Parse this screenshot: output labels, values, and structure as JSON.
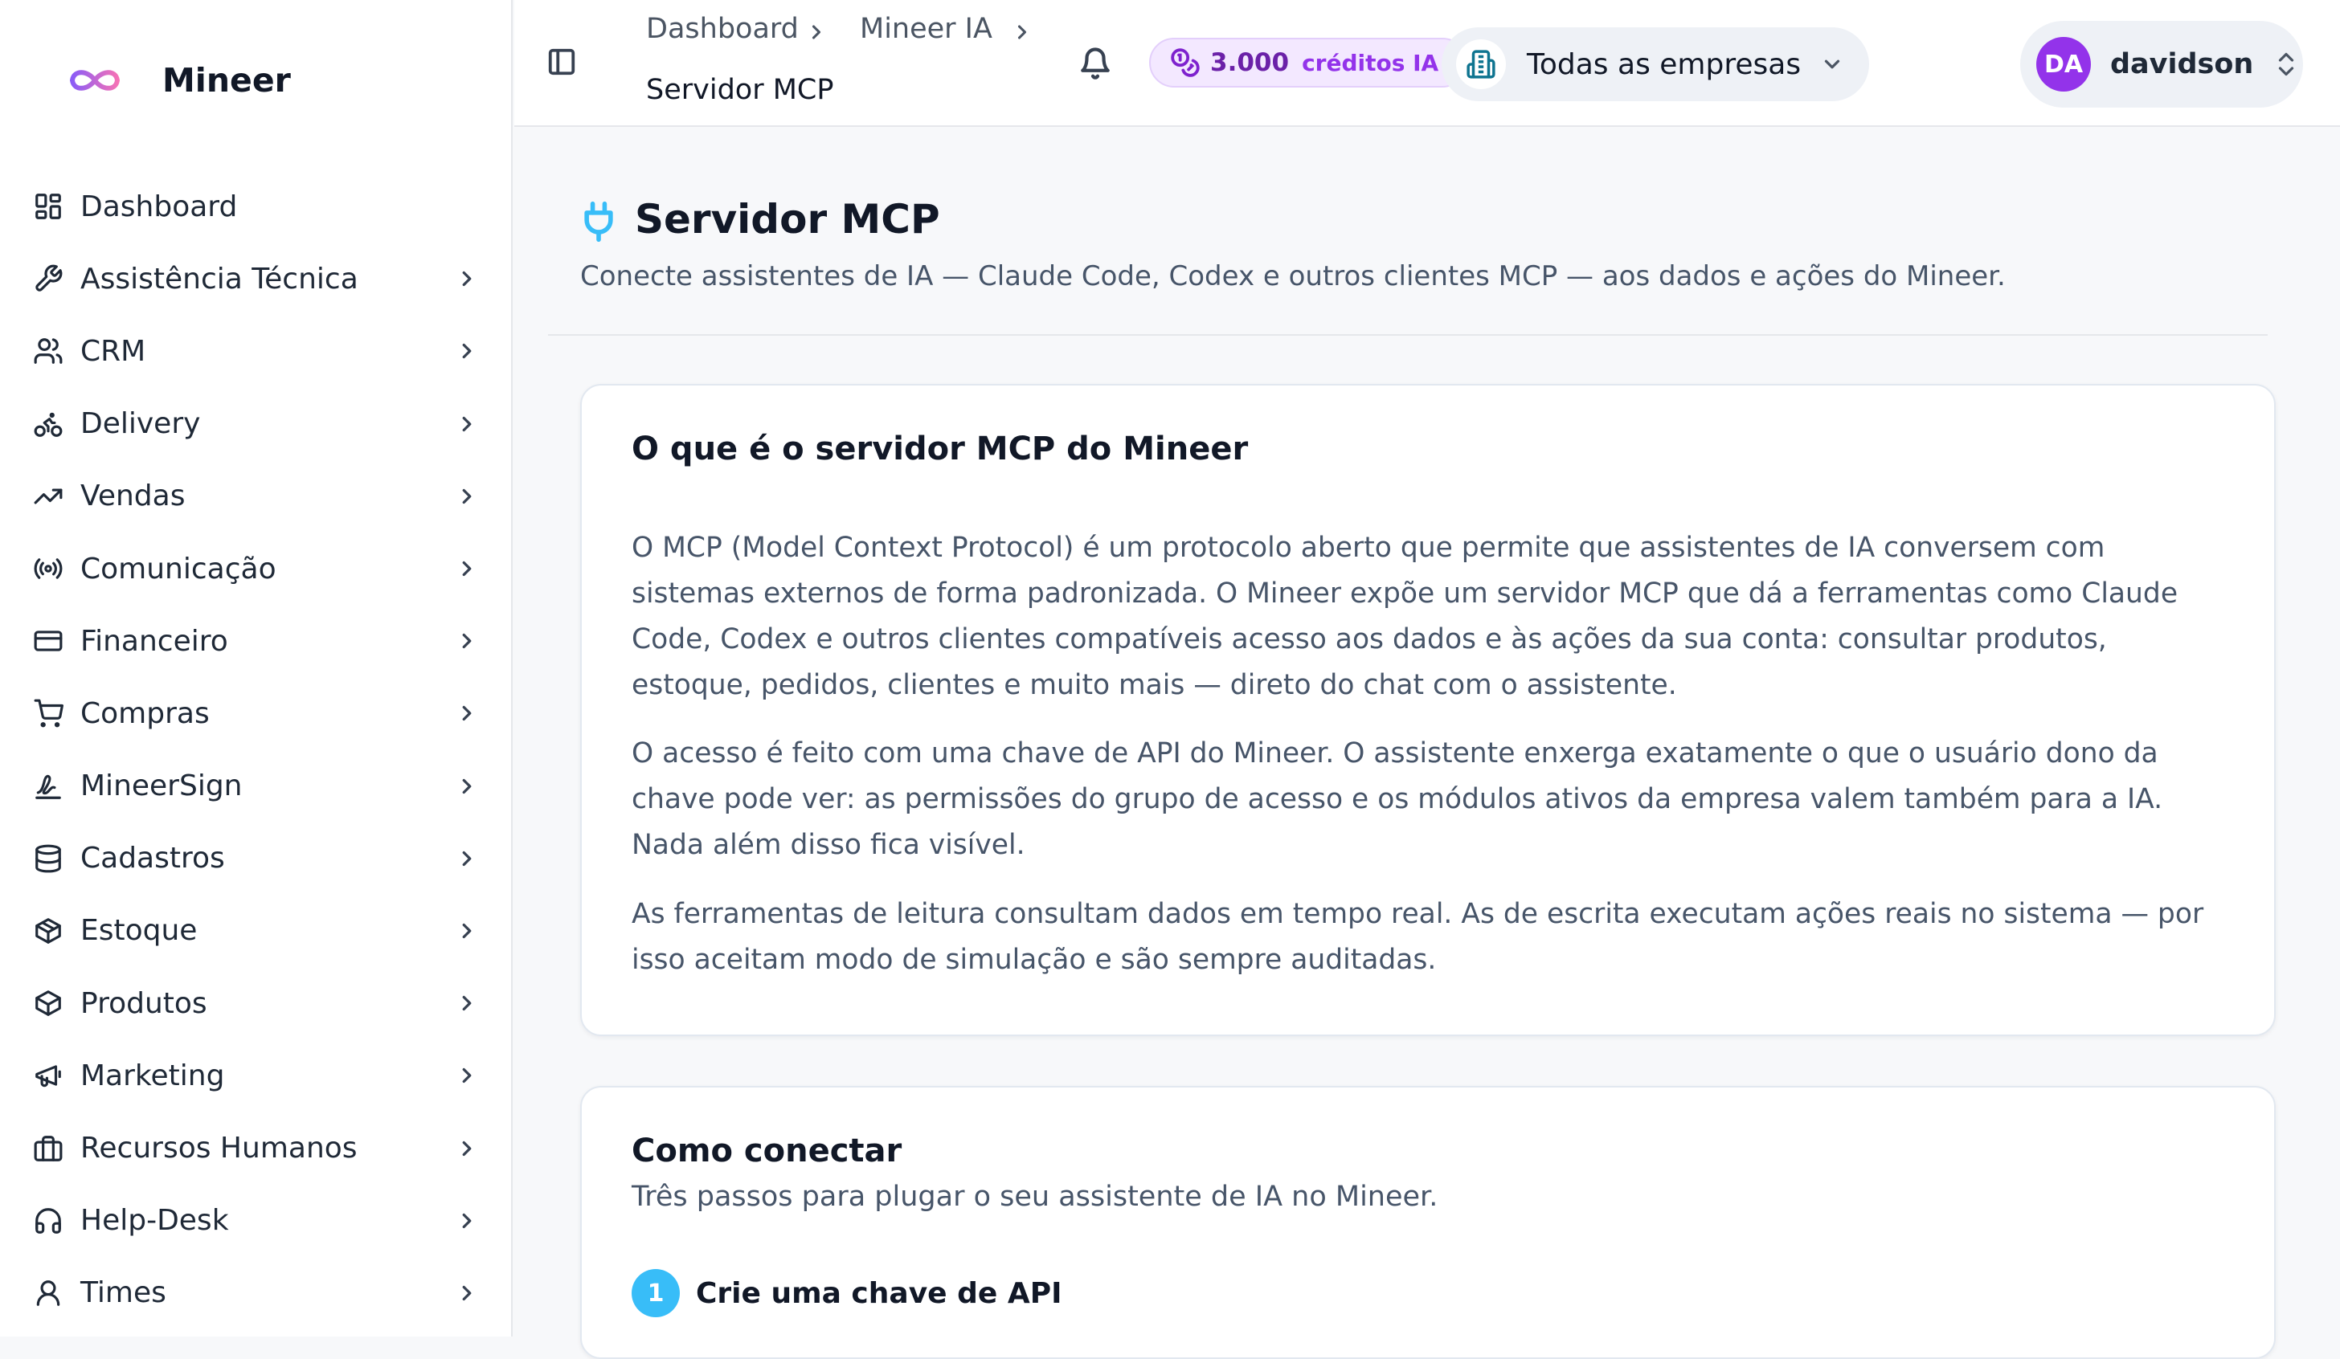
{
  "brand": {
    "name": "Mineer",
    "logo_icon": "infinity-logo"
  },
  "sidebar": {
    "items": [
      {
        "label": "Dashboard",
        "icon": "dashboard-icon",
        "has_children": false
      },
      {
        "label": "Assistência Técnica",
        "icon": "wrench-icon",
        "has_children": true
      },
      {
        "label": "CRM",
        "icon": "users-icon",
        "has_children": true
      },
      {
        "label": "Delivery",
        "icon": "bike-icon",
        "has_children": true
      },
      {
        "label": "Vendas",
        "icon": "trending-up-icon",
        "has_children": true
      },
      {
        "label": "Comunicação",
        "icon": "radio-icon",
        "has_children": true
      },
      {
        "label": "Financeiro",
        "icon": "credit-card-icon",
        "has_children": true
      },
      {
        "label": "Compras",
        "icon": "shopping-cart-icon",
        "has_children": true
      },
      {
        "label": "MineerSign",
        "icon": "signature-icon",
        "has_children": true
      },
      {
        "label": "Cadastros",
        "icon": "database-icon",
        "has_children": true
      },
      {
        "label": "Estoque",
        "icon": "package-icon",
        "has_children": true
      },
      {
        "label": "Produtos",
        "icon": "box-icon",
        "has_children": true
      },
      {
        "label": "Marketing",
        "icon": "megaphone-icon",
        "has_children": true
      },
      {
        "label": "Recursos Humanos",
        "icon": "briefcase-icon",
        "has_children": true
      },
      {
        "label": "Help-Desk",
        "icon": "headphones-icon",
        "has_children": true
      },
      {
        "label": "Times",
        "icon": "user-icon",
        "has_children": true
      }
    ]
  },
  "header": {
    "breadcrumb": [
      "Dashboard",
      "Mineer IA",
      "Servidor MCP"
    ],
    "credits": {
      "amount": "3.000",
      "label": "créditos IA"
    },
    "company_selector": "Todas as empresas",
    "user": {
      "initials": "DA",
      "name": "davidson"
    }
  },
  "page": {
    "title": "Servidor MCP",
    "subtitle": "Conecte assistentes de IA — Claude Code, Codex e outros clientes MCP — aos dados e ações do Mineer."
  },
  "what_is": {
    "title": "O que é o servidor MCP do Mineer",
    "paragraphs": [
      "O MCP (Model Context Protocol) é um protocolo aberto que permite que assistentes de IA conversem com sistemas externos de forma padronizada. O Mineer expõe um servidor MCP que dá a ferramentas como Claude Code, Codex e outros clientes compatíveis acesso aos dados e às ações da sua conta: consultar produtos, estoque, pedidos, clientes e muito mais — direto do chat com o assistente.",
      "O acesso é feito com uma chave de API do Mineer. O assistente enxerga exatamente o que o usuário dono da chave pode ver: as permissões do grupo de acesso e os módulos ativos da empresa valem também para a IA. Nada além disso fica visível.",
      "As ferramentas de leitura consultam dados em tempo real. As de escrita executam ações reais no sistema — por isso aceitam modo de simulação e são sempre auditadas."
    ]
  },
  "how_to": {
    "title": "Como conectar",
    "subtitle": "Três passos para plugar o seu assistente de IA no Mineer.",
    "steps": [
      {
        "number": "1",
        "title": "Crie uma chave de API"
      }
    ]
  },
  "colors": {
    "accent": "#38bdf8",
    "credits_bg": "#f3e8ff",
    "avatar": "#9333ea",
    "credits_text": "#6b21a8"
  }
}
